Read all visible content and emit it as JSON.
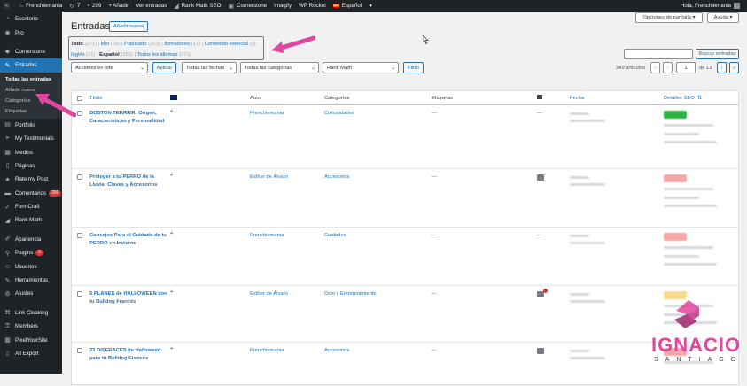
{
  "adminbar": {
    "site": "Frenchiemania",
    "updates": "7",
    "comments": "299",
    "new_label": "+ Añadir",
    "items": [
      "Ver entradas",
      "Rank Math SEO",
      "Cornerstone",
      "Imagify",
      "WP Rocket",
      "Español"
    ],
    "greeting": "Hola, Frenchiemania"
  },
  "sidebar": {
    "items": [
      {
        "label": "Escritorio",
        "icon": "dashboard-icon"
      },
      {
        "label": "Pro",
        "icon": "pro-icon"
      },
      {
        "label": "Cornerstone",
        "icon": "cornerstone-icon"
      },
      {
        "label": "Entradas",
        "icon": "pin-icon"
      },
      {
        "label": "Portfolio",
        "icon": "portfolio-icon"
      },
      {
        "label": "My Testimonials",
        "icon": "testimonials-icon"
      },
      {
        "label": "Medios",
        "icon": "media-icon"
      },
      {
        "label": "Páginas",
        "icon": "pages-icon"
      },
      {
        "label": "Rate my Post",
        "icon": "star-icon"
      },
      {
        "label": "Comentarios",
        "icon": "comments-icon",
        "badge": "299"
      },
      {
        "label": "FormCraft",
        "icon": "formcraft-icon"
      },
      {
        "label": "Rank Math",
        "icon": "rankmath-icon"
      },
      {
        "label": "Apariencia",
        "icon": "brush-icon"
      },
      {
        "label": "Plugins",
        "icon": "plugin-icon",
        "badge": "6"
      },
      {
        "label": "Usuarios",
        "icon": "users-icon"
      },
      {
        "label": "Herramientas",
        "icon": "tools-icon"
      },
      {
        "label": "Ajustes",
        "icon": "settings-icon"
      },
      {
        "label": "Link Cloaking",
        "icon": "link-icon"
      },
      {
        "label": "Members",
        "icon": "members-icon"
      },
      {
        "label": "PixelYourSite",
        "icon": "pixel-icon"
      },
      {
        "label": "All Export",
        "icon": "export-icon"
      }
    ],
    "submenu": [
      "Todas las entradas",
      "Añadir nueva",
      "Categorías",
      "Etiquetas"
    ]
  },
  "header": {
    "title": "Entradas",
    "add_new": "Añadir nueva",
    "screen_options": "Opciones de pantalla ▾",
    "help": "Ayuda ▾"
  },
  "views": {
    "todo": "Todo",
    "todo_count": "(271)",
    "mio": "Mío",
    "mio_count": "(28)",
    "publicado": "Publicado",
    "publicado_count": "(253)",
    "borradores": "Borradores",
    "borradores_count": "(17)",
    "contenido": "Contenido esencial",
    "contenido_count": "(0)",
    "ingles": "Inglés",
    "ingles_count": "(21)",
    "espanol": "Español",
    "espanol_count": "(250)",
    "todos_idiomas": "Todos los idiomas",
    "todos_idiomas_count": "(271)"
  },
  "search": {
    "button": "Buscar entradas"
  },
  "filters": {
    "bulk": "Acciones en lote",
    "apply": "Aplicar",
    "dates": "Todas las fechas",
    "categories": "Todas las categorías",
    "rankmath": "Rank Math",
    "filter": "Filtro"
  },
  "pagination": {
    "count": "249 artículos",
    "first": "«",
    "prev": "‹",
    "current": "1",
    "of": "de 13",
    "next": "›",
    "last": "»"
  },
  "table": {
    "headers": {
      "title": "Título",
      "author": "Autor",
      "categories": "Categorías",
      "tags": "Etiquetas",
      "date": "Fecha",
      "seo": "Detalles SEO"
    },
    "rows": [
      {
        "title": "BOSTON TERRIER: Origen, Características y Personalidad",
        "author": "Frenchiemania",
        "category": "Curiosidades",
        "tags": "—",
        "seo_color": "#2fb344"
      },
      {
        "title": "Proteger a tu PERRO de la Lluvia: Claves y Accesorios",
        "author": "Esther de Álvaro",
        "category": "Accesorios",
        "tags": "—",
        "seo_color": "#f4a7a7"
      },
      {
        "title": "Consejos Para el Cuidado de tu PERRO en Invierno",
        "author": "Frenchiemania",
        "category": "Cuidados",
        "tags": "—",
        "seo_color": "#f4a7a7"
      },
      {
        "title": "5 PLANES de HALLOWEEN con tu Bulldog Francés",
        "author": "Esther de Álvaro",
        "category": "Ocio y Entretenimiento",
        "tags": "—",
        "seo_color": "#f7d98a"
      },
      {
        "title": "22 DISFRACES de Halloween para tu Bulldog Francés",
        "author": "Frenchiemania",
        "category": "Accesorios",
        "tags": "—",
        "seo_color": "#f4a7a7"
      }
    ]
  },
  "watermark": {
    "name": "IGNACIO",
    "sub": "SANTIAGO",
    "brand_color": "#e0479e"
  },
  "colors": {
    "accent": "#2271b1",
    "highlight": "#d63bb0",
    "admin_dark": "#1d2327"
  }
}
